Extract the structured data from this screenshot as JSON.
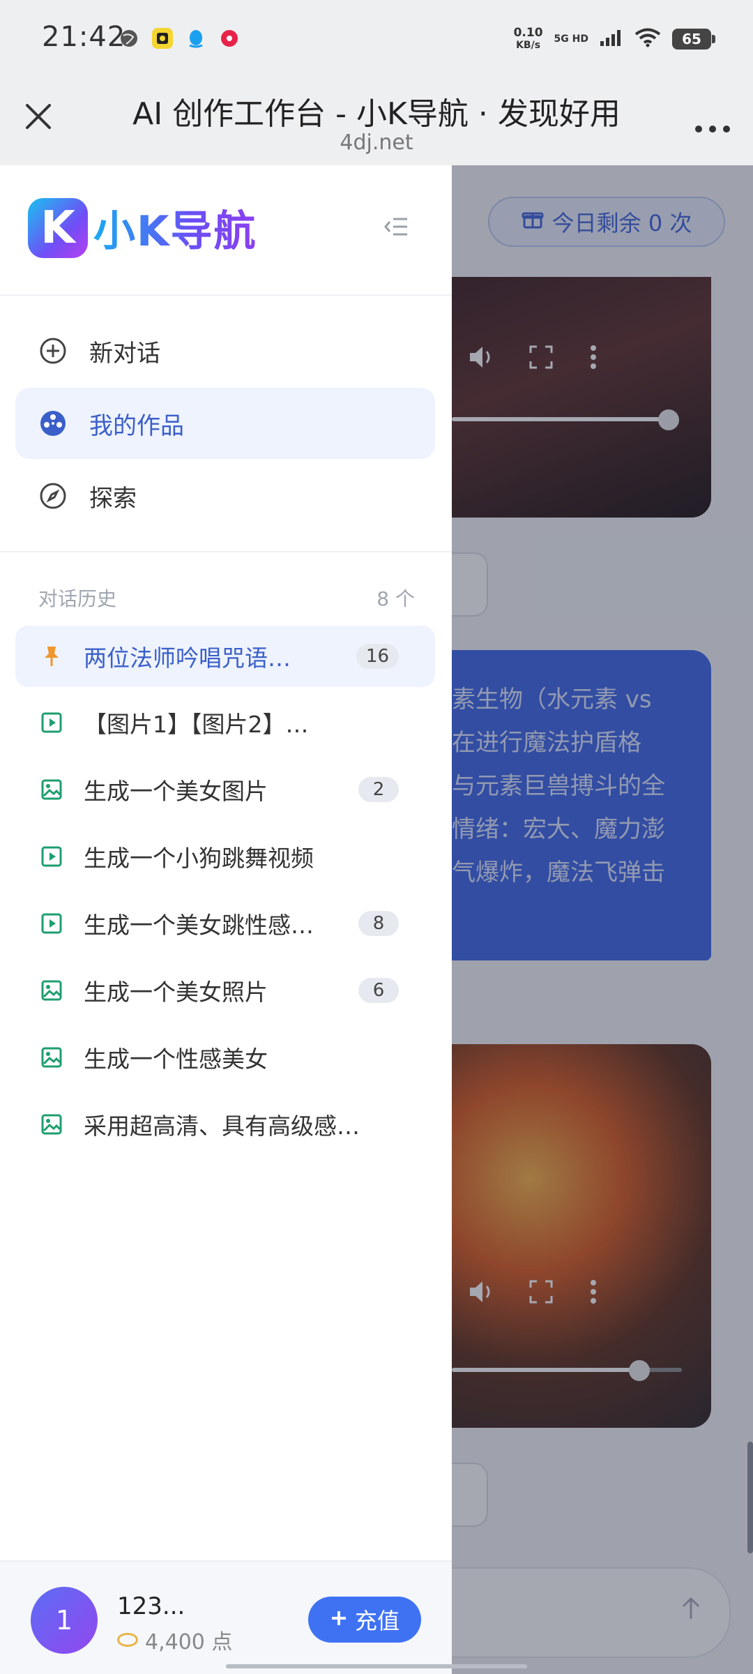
{
  "status_bar": {
    "time": "21:42",
    "speed_value": "0.10",
    "speed_unit": "KB/s",
    "network": "5G HD",
    "battery": "65",
    "icons": [
      "globe-icon",
      "app-icon",
      "qq-icon",
      "music-icon",
      "signal-icon",
      "wifi-icon"
    ]
  },
  "titlebar": {
    "title": "AI 创作工作台 - 小K导航 · 发现好用",
    "url": "4dj.net"
  },
  "background_page": {
    "quota_label": "今日剩余 0 次",
    "bubble_lines": [
      "素生物（水元素 vs",
      "在进行魔法护盾格",
      "与元素巨兽搏斗的全",
      "情绪：宏大、魔力澎",
      "气爆炸，魔法飞弹击"
    ]
  },
  "drawer": {
    "logo_text": "小K导航",
    "logo_mark": "K",
    "nav": [
      {
        "label": "新对话",
        "icon": "plus-circle-icon"
      },
      {
        "label": "我的作品",
        "icon": "film-reel-icon"
      },
      {
        "label": "探索",
        "icon": "compass-icon"
      }
    ],
    "history_title": "对话历史",
    "history_count": "8 个",
    "history": [
      {
        "label": "两位法师吟唱咒语…",
        "count": "16",
        "icon": "pin-icon"
      },
      {
        "label": "【图片1】【图片2】…",
        "count": "",
        "icon": "video-icon"
      },
      {
        "label": "生成一个美女图片",
        "count": "2",
        "icon": "image-icon"
      },
      {
        "label": "生成一个小狗跳舞视频",
        "count": "",
        "icon": "video-icon"
      },
      {
        "label": "生成一个美女跳性感…",
        "count": "8",
        "icon": "video-icon"
      },
      {
        "label": "生成一个美女照片",
        "count": "6",
        "icon": "image-icon"
      },
      {
        "label": "生成一个性感美女",
        "count": "",
        "icon": "image-icon"
      },
      {
        "label": "采用超高清、具有高级感…",
        "count": "",
        "icon": "image-icon"
      }
    ],
    "user": {
      "avatar": "1",
      "name": "123...",
      "points": "4,400 点",
      "recharge_label": "充值"
    }
  },
  "colors": {
    "accent": "#3f72f3",
    "active_bg": "#eef3fd",
    "active_text": "#3b5fc9",
    "pin": "#f0962c",
    "media_icon": "#1e9e6e"
  }
}
